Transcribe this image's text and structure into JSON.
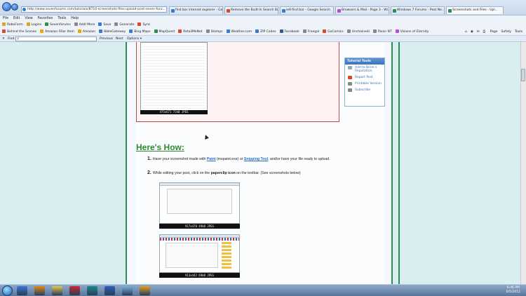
{
  "browser": {
    "url": "http://www.sevenforums.com/tutorials/8710-screenshots-files-upload-post-seven-foru...",
    "tabs": [
      {
        "label": "find bar internet explorer - Go...",
        "color": "#3a78d8"
      },
      {
        "label": "Remove the Built-In Search Ba...",
        "color": "#d84a2b"
      },
      {
        "label": "ie9 find bar - Google Search",
        "color": "#3a78d8"
      },
      {
        "label": "Browsers & Mail - Page 3 - Wi...",
        "color": "#b84ad8"
      },
      {
        "label": "Windows 7 Forums - Post Ne...",
        "color": "#2f8a53"
      },
      {
        "label": "Screenshots and Files - Upl...",
        "color": "#2f8a53",
        "active": true
      }
    ]
  },
  "menu": [
    "File",
    "Edit",
    "View",
    "Favorites",
    "Tools",
    "Help"
  ],
  "favbar1": [
    {
      "label": "RoboForm",
      "color": "#d8a22b"
    },
    {
      "label": "Logins",
      "color": "#d8a22b"
    },
    {
      "label": "Sevenforums",
      "color": "#2f8a53"
    },
    {
      "label": "Addl More",
      "color": "#888"
    },
    {
      "label": "Save",
      "color": "#3a78d8"
    },
    {
      "label": "Generate",
      "color": "#888"
    },
    {
      "label": "Sync",
      "color": "#d84a2b"
    }
  ],
  "favbar2": [
    {
      "label": "Behind the Scenes",
      "color": "#d84a2b"
    },
    {
      "label": "Amazon Filler Item",
      "color": "#f0a500"
    },
    {
      "label": "Amazon",
      "color": "#f0a500"
    },
    {
      "label": "BibleGateway",
      "color": "#3a78d8"
    },
    {
      "label": "Bing Maps",
      "color": "#3a78d8"
    },
    {
      "label": "MapQuest",
      "color": "#2f8a53"
    },
    {
      "label": "RetailMeNot",
      "color": "#d84a2b"
    },
    {
      "label": "Stamps",
      "color": "#888"
    },
    {
      "label": "Weather.com",
      "color": "#3a78d8"
    },
    {
      "label": "ZIP Codes",
      "color": "#3a78d8"
    },
    {
      "label": "Facebook",
      "color": "#3b5998"
    },
    {
      "label": "Freegal",
      "color": "#888"
    },
    {
      "label": "GoComics",
      "color": "#d84a2b"
    },
    {
      "label": "Unchainedi",
      "color": "#888"
    },
    {
      "label": "Panin NT",
      "color": "#888"
    },
    {
      "label": "Visions of Eternity",
      "color": "#b84ad8"
    }
  ],
  "rtools": [
    "Page",
    "Safety",
    "Tools"
  ],
  "find": {
    "label": "Find:",
    "value": "f",
    "prev": "Previous",
    "next": "Next",
    "options": "Options"
  },
  "sidepanel": {
    "title": "Tutorial Tools",
    "items": [
      {
        "label": "Add to Brink's Reputation",
        "color": "#9aa6b4"
      },
      {
        "label": "Report Post",
        "color": "#d84a2b"
      },
      {
        "label": "Printable Version",
        "color": "#888"
      },
      {
        "label": "Subscribe",
        "color": "#888"
      }
    ]
  },
  "captions": {
    "top": "475x671  72kB  JPEG",
    "shot1": "917x478  49kB  JPEG",
    "shot2": "913x442  69kB  JPEG"
  },
  "howto": "Here's How:",
  "steps": [
    {
      "num": "1.",
      "pre": "Have your screenshot made with ",
      "link1": "Paint",
      "mid1": " (mspaint.exe) or ",
      "link2": "Snipping Tool",
      "post": ", and/or have your file ready to upload."
    },
    {
      "num": "2.",
      "pre": "While editing your post, click on the ",
      "bold": "paperclip icon",
      "post": " on the toolbar. (See screenshots below)"
    }
  ],
  "taskbar": {
    "apps": [
      {
        "name": "ie",
        "color": "#3a78d8"
      },
      {
        "name": "media",
        "color": "#e08a1a"
      },
      {
        "name": "folder",
        "color": "#e8c34b"
      },
      {
        "name": "quicken",
        "color": "#c82b2b"
      },
      {
        "name": "publisher",
        "color": "#1a8a8a"
      },
      {
        "name": "word",
        "color": "#2b5fb5"
      },
      {
        "name": "app7",
        "color": "#7ab0d8"
      },
      {
        "name": "outlook",
        "color": "#e0a020"
      }
    ],
    "time": "6:46 PM",
    "date": "6/5/2012"
  }
}
